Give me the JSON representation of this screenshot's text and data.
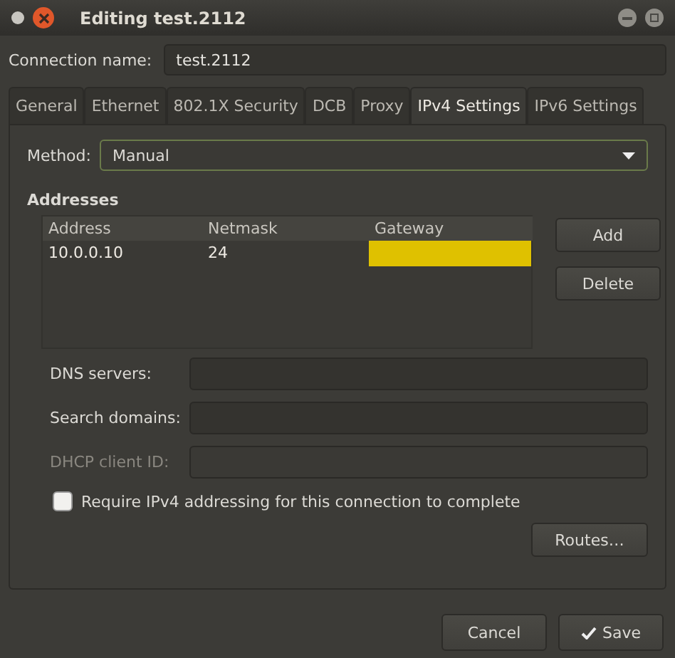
{
  "window": {
    "title": "Editing test.2112"
  },
  "connection_name": {
    "label": "Connection name:",
    "value": "test.2112"
  },
  "tabs": [
    {
      "label": "General",
      "selected": false
    },
    {
      "label": "Ethernet",
      "selected": false
    },
    {
      "label": "802.1X Security",
      "selected": false
    },
    {
      "label": "DCB",
      "selected": false
    },
    {
      "label": "Proxy",
      "selected": false
    },
    {
      "label": "IPv4 Settings",
      "selected": true
    },
    {
      "label": "IPv6 Settings",
      "selected": false
    }
  ],
  "method": {
    "label": "Method:",
    "value": "Manual"
  },
  "addresses": {
    "heading": "Addresses",
    "columns": [
      "Address",
      "Netmask",
      "Gateway"
    ],
    "rows": [
      {
        "address": "10.0.0.10",
        "netmask": "24",
        "gateway_editing": true
      }
    ],
    "buttons": [
      "Add",
      "Delete"
    ]
  },
  "fields": [
    {
      "label": "DNS servers:",
      "disabled": false
    },
    {
      "label": "Search domains:",
      "disabled": false
    },
    {
      "label": "DHCP client ID:",
      "disabled": true
    }
  ],
  "require_checkbox": {
    "label": "Require IPv4 addressing for this connection to complete",
    "checked": false
  },
  "routes_button": "Routes…",
  "footer_buttons": [
    {
      "label": "Cancel",
      "kind": "plain"
    },
    {
      "label": "Save",
      "kind": "confirm"
    }
  ]
}
